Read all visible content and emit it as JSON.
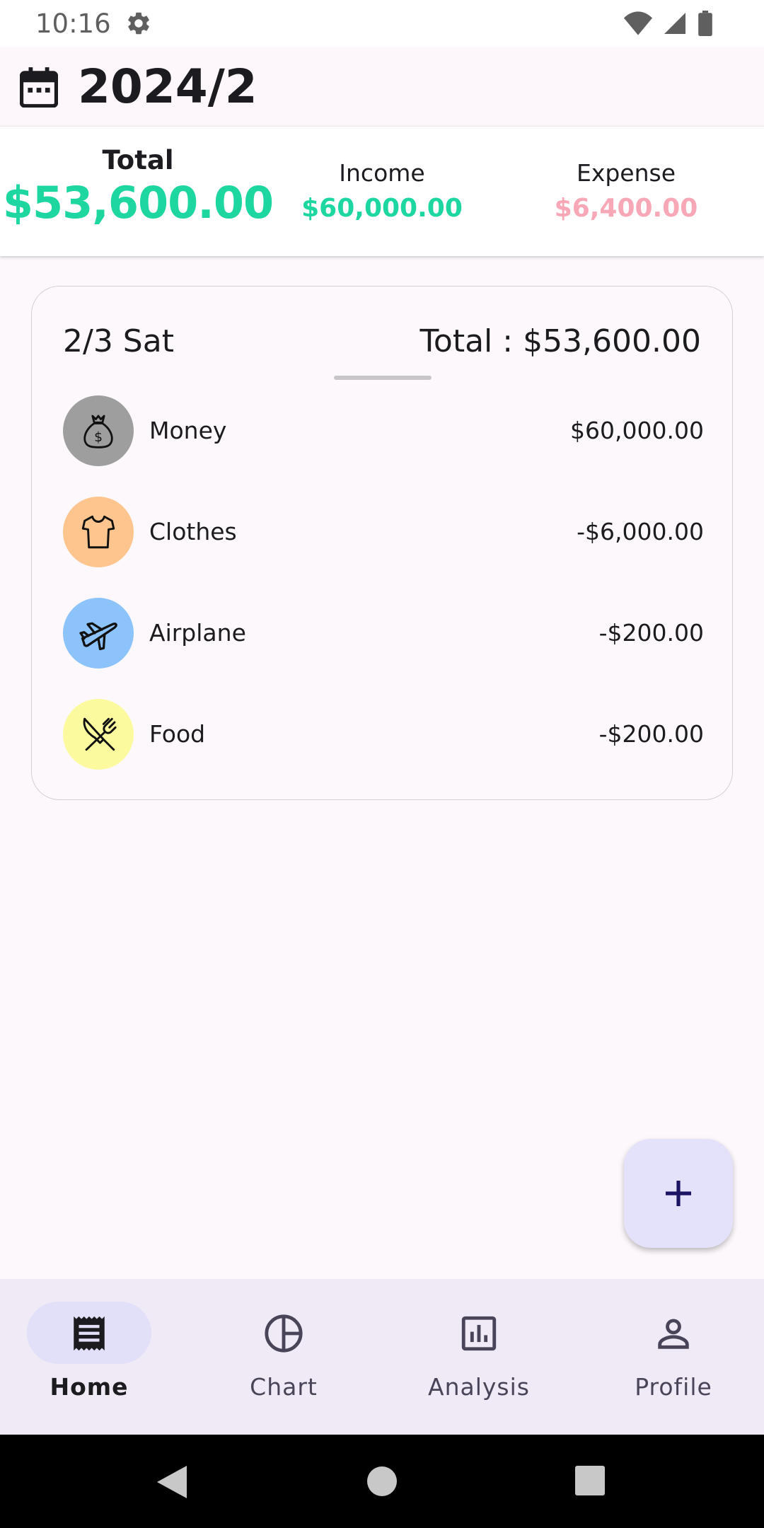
{
  "status_bar": {
    "time": "10:16"
  },
  "header": {
    "month": "2024/2"
  },
  "summary": {
    "total_label": "Total",
    "total_value": "$53,600.00",
    "income_label": "Income",
    "income_value": "$60,000.00",
    "expense_label": "Expense",
    "expense_value": "$6,400.00"
  },
  "day_card": {
    "date": "2/3 Sat",
    "total": "Total : $53,600.00",
    "entries": [
      {
        "name": "Money",
        "amount": "$60,000.00",
        "icon": "money-bag-icon",
        "color": "#9e9e9e"
      },
      {
        "name": "Clothes",
        "amount": "-$6,000.00",
        "icon": "tshirt-icon",
        "color": "#ffc58f"
      },
      {
        "name": "Airplane",
        "amount": "-$200.00",
        "icon": "airplane-icon",
        "color": "#8cc3fb"
      },
      {
        "name": "Food",
        "amount": "-$200.00",
        "icon": "utensils-icon",
        "color": "#fcfa9e"
      }
    ]
  },
  "bottom_nav": {
    "items": [
      {
        "label": "Home",
        "icon": "receipt-icon",
        "active": true
      },
      {
        "label": "Chart",
        "icon": "pie-chart-icon",
        "active": false
      },
      {
        "label": "Analysis",
        "icon": "bar-chart-icon",
        "active": false
      },
      {
        "label": "Profile",
        "icon": "person-icon",
        "active": false
      }
    ]
  },
  "colors": {
    "income": "#1ed6a0",
    "expense": "#f7a7b5",
    "background": "#fdf8fc",
    "nav_background": "#efeaf5",
    "fab": "#e4e2fa"
  }
}
